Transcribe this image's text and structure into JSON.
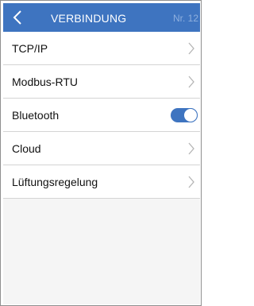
{
  "header": {
    "title": "VERBINDUNG",
    "number": "Nr. 12",
    "back_icon": "chevron-left-icon",
    "background": "#3e74c0"
  },
  "menu": {
    "items": [
      {
        "label": "TCP/IP",
        "control": "chevron-right-icon"
      },
      {
        "label": "Modbus-RTU",
        "control": "chevron-right-icon"
      },
      {
        "label": "Bluetooth",
        "control": "toggle",
        "toggle_on": true
      },
      {
        "label": "Cloud",
        "control": "chevron-right-icon"
      },
      {
        "label": "Lüftungsregelung",
        "control": "chevron-right-icon"
      }
    ]
  },
  "colors": {
    "accent": "#3e74c0",
    "chevron": "#b5b5b5",
    "empty_area": "#f5f5f5"
  }
}
